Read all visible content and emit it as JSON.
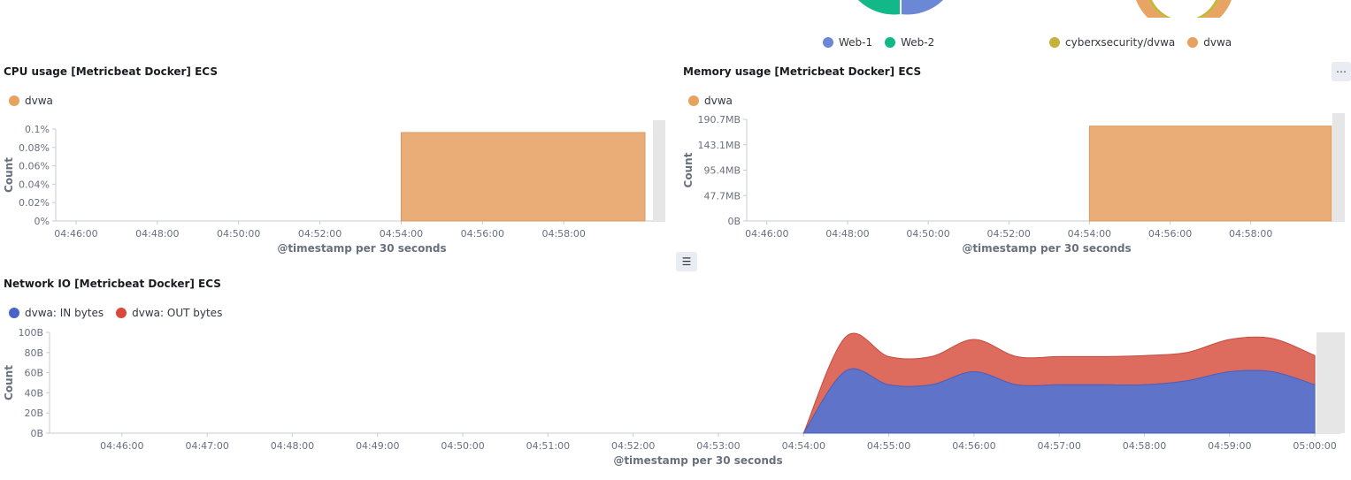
{
  "top": {
    "legend_left": [
      {
        "label": "Web-1",
        "color": "#6092c0"
      },
      {
        "label": "Web-2",
        "color": "#0bb48c"
      }
    ],
    "legend_right": [
      {
        "label": "cyberxsecurity/dvwa",
        "color": "#c8b03c"
      },
      {
        "label": "dvwa",
        "color": "#e7a160"
      }
    ],
    "pie_colors": {
      "web1": "#6a88d6",
      "web2": "#12b887",
      "outer": "#e8a464",
      "inner": "#c9b440"
    }
  },
  "cpu": {
    "title": "CPU usage [Metricbeat Docker] ECS",
    "legend": [
      {
        "label": "dvwa",
        "color": "#e7a160"
      }
    ],
    "chart_data": {
      "type": "bar",
      "xlabel": "@timestamp per 30 seconds",
      "ylabel": "Count",
      "x_ticks": [
        "04:46:00",
        "04:48:00",
        "04:50:00",
        "04:52:00",
        "04:54:00",
        "04:56:00",
        "04:58:00"
      ],
      "y_ticks": [
        "0%",
        "0.02%",
        "0.04%",
        "0.06%",
        "0.08%",
        "0.1%"
      ],
      "series": [
        {
          "name": "dvwa",
          "color": "#eaad78",
          "x_start": "04:54:00",
          "x_end": "05:00:00",
          "value": 0.1
        }
      ]
    }
  },
  "memory": {
    "title": "Memory usage [Metricbeat Docker] ECS",
    "legend": [
      {
        "label": "dvwa",
        "color": "#e7a160"
      }
    ],
    "chart_data": {
      "type": "bar",
      "xlabel": "@timestamp per 30 seconds",
      "ylabel": "Count",
      "x_ticks": [
        "04:46:00",
        "04:48:00",
        "04:50:00",
        "04:52:00",
        "04:54:00",
        "04:56:00",
        "04:58:00"
      ],
      "y_ticks": [
        "0B",
        "47.7MB",
        "95.4MB",
        "143.1MB",
        "190.7MB"
      ],
      "series": [
        {
          "name": "dvwa",
          "color": "#eaad78",
          "x_start": "04:54:00",
          "x_end": "05:00:00",
          "value_mb": 178
        }
      ]
    }
  },
  "network": {
    "title": "Network IO [Metricbeat Docker] ECS",
    "legend": [
      {
        "label": "dvwa: IN bytes",
        "color": "#4a63c9"
      },
      {
        "label": "dvwa: OUT bytes",
        "color": "#d9483b"
      }
    ],
    "chart_data": {
      "type": "area",
      "stacked": true,
      "xlabel": "@timestamp per 30 seconds",
      "ylabel": "Count",
      "x_ticks": [
        "04:46:00",
        "04:47:00",
        "04:48:00",
        "04:49:00",
        "04:50:00",
        "04:51:00",
        "04:52:00",
        "04:53:00",
        "04:54:00",
        "04:55:00",
        "04:56:00",
        "04:57:00",
        "04:58:00",
        "04:59:00",
        "05:00:00"
      ],
      "y_ticks": [
        "0B",
        "20B",
        "40B",
        "60B",
        "80B",
        "100B"
      ],
      "ylim": [
        0,
        100
      ],
      "x": [
        "04:54:00",
        "04:54:30",
        "04:55:00",
        "04:55:30",
        "04:56:00",
        "04:56:30",
        "04:57:00",
        "04:57:30",
        "04:58:00",
        "04:58:30",
        "04:59:00",
        "04:59:30",
        "05:00:00"
      ],
      "series": [
        {
          "name": "dvwa: IN bytes",
          "color": "#5f73c9",
          "values": [
            0,
            62,
            48,
            48,
            61,
            48,
            48,
            48,
            48,
            52,
            61,
            61,
            48
          ]
        },
        {
          "name": "dvwa: OUT bytes",
          "color": "#dd6b5e",
          "values": [
            0,
            34,
            28,
            28,
            32,
            28,
            28,
            28,
            29,
            28,
            32,
            33,
            29
          ]
        }
      ]
    }
  },
  "icons": {
    "options": "⋯",
    "legend_toggle": "☰"
  }
}
